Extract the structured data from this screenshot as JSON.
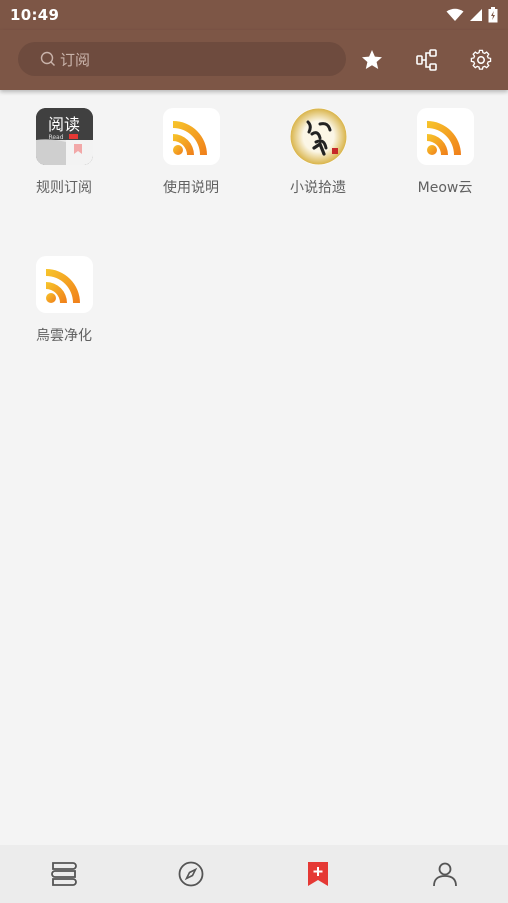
{
  "status": {
    "time": "10:49"
  },
  "search": {
    "placeholder": "订阅"
  },
  "subscriptions": [
    {
      "label": "规则订阅",
      "icon": "read-app-icon",
      "icon_title": "阅读",
      "icon_subtitle": "Read"
    },
    {
      "label": "使用说明",
      "icon": "rss-icon"
    },
    {
      "label": "小说拾遗",
      "icon": "book-emblem-icon"
    },
    {
      "label": "Meow云",
      "icon": "rss-icon"
    },
    {
      "label": "烏雲净化",
      "icon": "rss-icon"
    }
  ],
  "colors": {
    "appbar": "#7d5646",
    "accent": "#e53935",
    "rss": "#f59a1b",
    "background": "#f4f4f4"
  },
  "bottom_nav": [
    "bookshelf-icon",
    "explore-icon",
    "subscription-icon",
    "profile-icon"
  ]
}
